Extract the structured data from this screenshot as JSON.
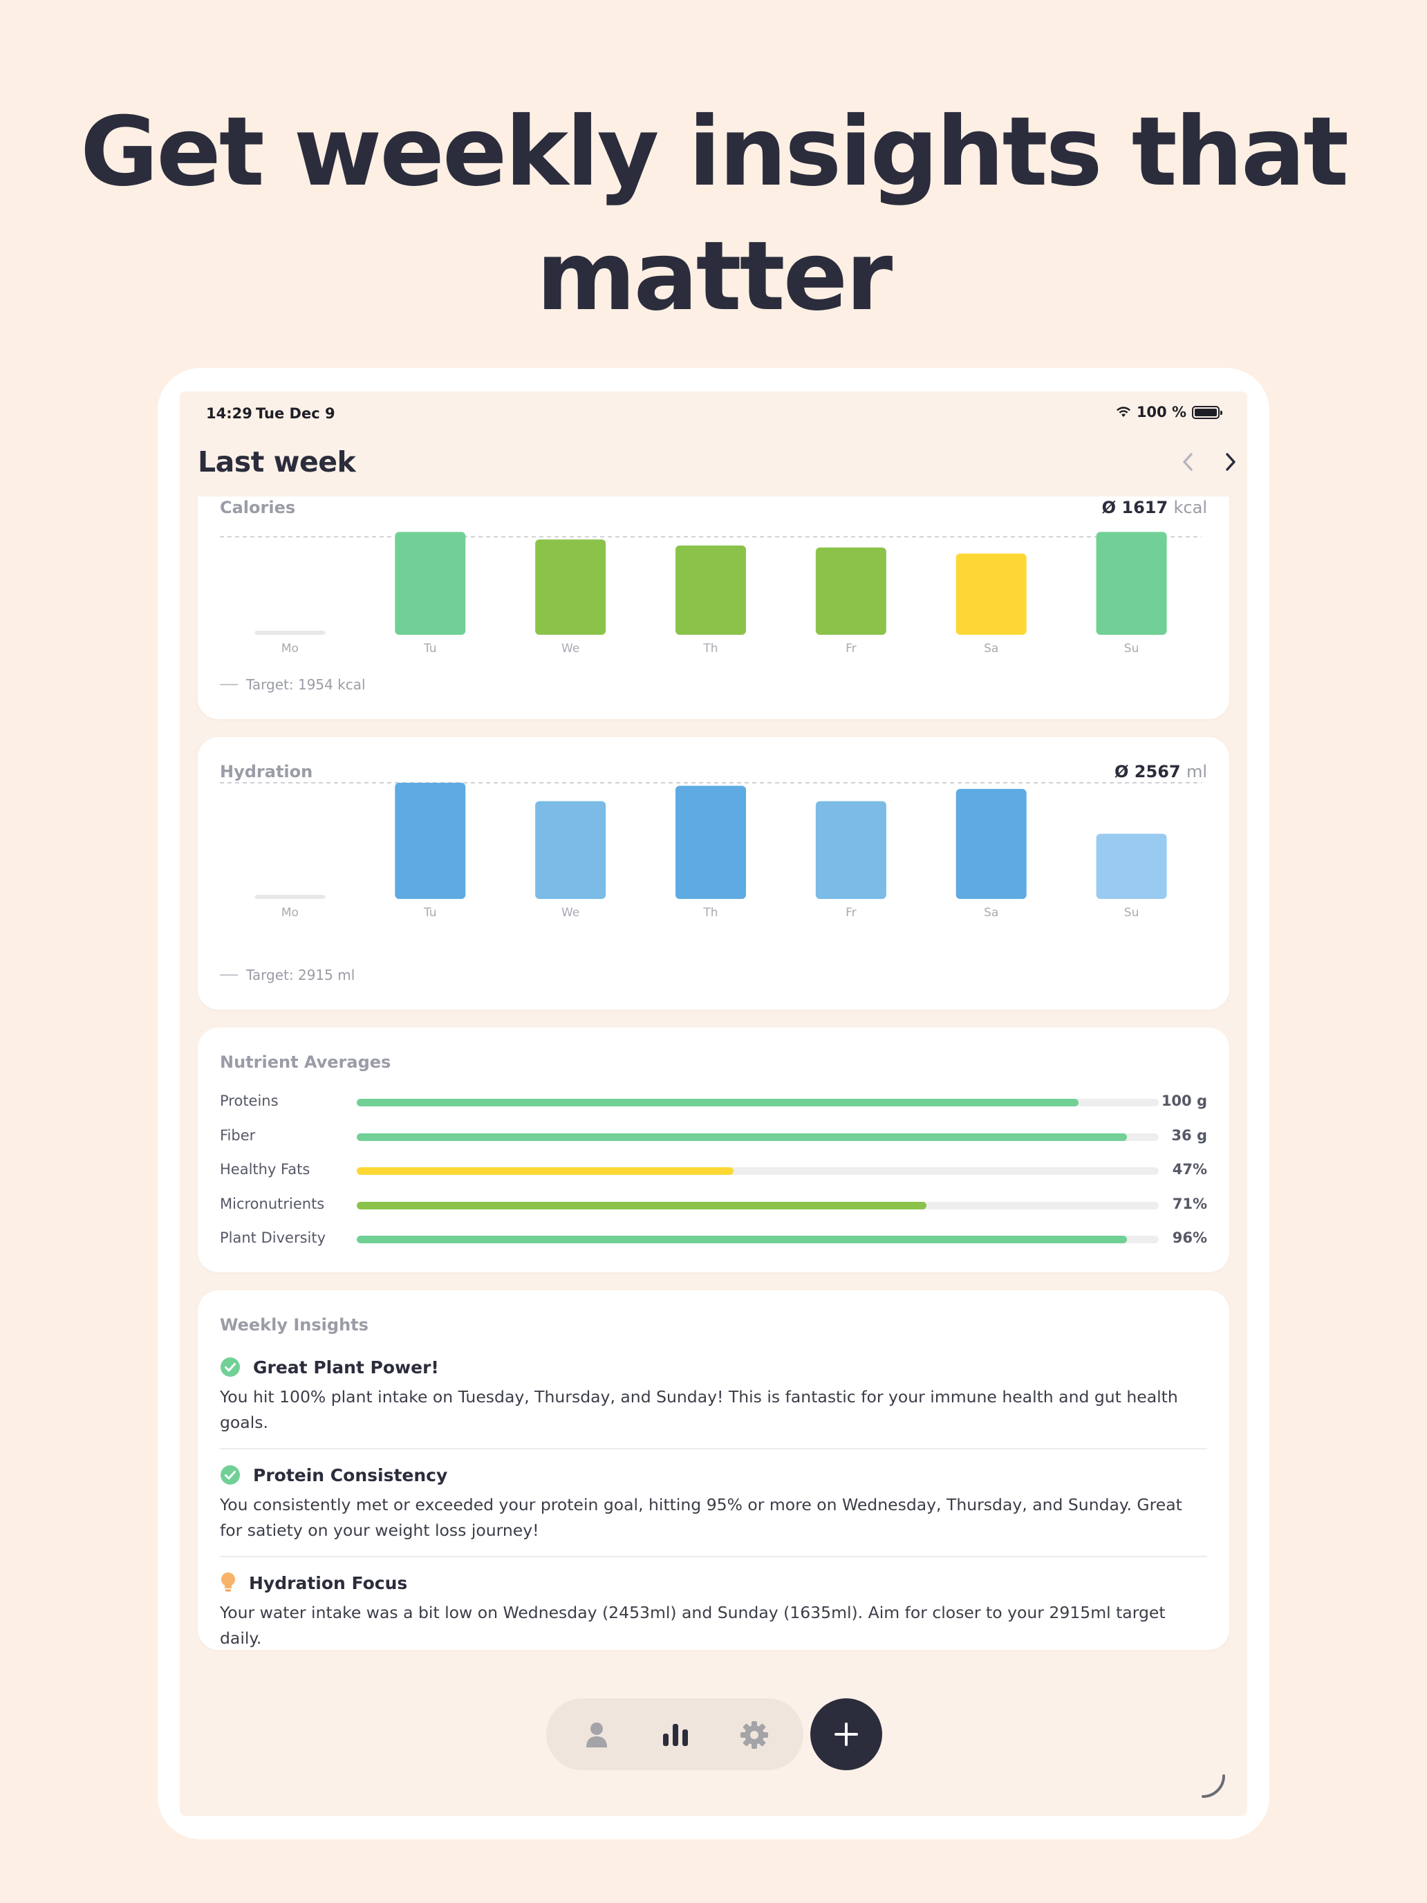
{
  "headline": {
    "line1": "Get weekly insights that",
    "line2": "matter"
  },
  "status": {
    "time": "14:29",
    "date": "Tue Dec 9",
    "battery": "100 %",
    "wifi_icon": "wifi-icon",
    "battery_icon": "battery-icon"
  },
  "nav": {
    "title": "Last week",
    "prev_icon": "chevron-left-icon",
    "next_icon": "chevron-right-icon"
  },
  "calories": {
    "title": "Calories",
    "avg_symbol": "Ø",
    "avg_value": "1617",
    "avg_unit": "kcal",
    "target_label": "Target: 1954 kcal"
  },
  "hydration": {
    "title": "Hydration",
    "avg_symbol": "Ø",
    "avg_value": "2567",
    "avg_unit": "ml",
    "target_label": "Target: 2915 ml"
  },
  "chart_data": [
    {
      "type": "bar",
      "title": "Calories",
      "categories": [
        "Mo",
        "Tu",
        "We",
        "Th",
        "Fr",
        "Sa",
        "Su"
      ],
      "values": [
        0,
        2050,
        1900,
        1780,
        1740,
        1620,
        2050
      ],
      "target": 1954,
      "ylim": [
        0,
        2150
      ],
      "colors": [
        "#e8e8e8",
        "#71d096",
        "#8bc34a",
        "#8bc34a",
        "#8bc34a",
        "#fdd835",
        "#71d096"
      ]
    },
    {
      "type": "bar",
      "title": "Hydration",
      "categories": [
        "Mo",
        "Tu",
        "We",
        "Th",
        "Fr",
        "Sa",
        "Su"
      ],
      "values": [
        0,
        2915,
        2453,
        2840,
        2453,
        2760,
        1635
      ],
      "target": 2915,
      "ylim": [
        0,
        2915
      ],
      "colors": [
        "#e8e8e8",
        "#5dabe2",
        "#7bbbe6",
        "#5dabe2",
        "#7bbbe6",
        "#5dabe2",
        "#98cbef"
      ]
    }
  ],
  "nutrients": {
    "title": "Nutrient Averages",
    "items": [
      {
        "label": "Proteins",
        "value": "100 g",
        "fraction": 0.9,
        "color": "#71d096"
      },
      {
        "label": "Fiber",
        "value": "36 g",
        "fraction": 0.96,
        "color": "#71d096"
      },
      {
        "label": "Healthy Fats",
        "value": "47%",
        "fraction": 0.47,
        "color": "#fdd835"
      },
      {
        "label": "Micronutrients",
        "value": "71%",
        "fraction": 0.71,
        "color": "#8bc34a"
      },
      {
        "label": "Plant Diversity",
        "value": "96%",
        "fraction": 0.96,
        "color": "#71d096"
      }
    ]
  },
  "insights": {
    "title": "Weekly Insights",
    "items": [
      {
        "icon": "check-circle-icon",
        "title": "Great Plant Power!",
        "body": "You hit 100% plant intake on Tuesday, Thursday, and Sunday! This is fantastic for your immune health and gut health goals."
      },
      {
        "icon": "check-circle-icon",
        "title": "Protein Consistency",
        "body": "You consistently met or exceeded your protein goal, hitting 95% or more on Wednesday, Thursday, and Sunday. Great for satiety on your weight loss journey!"
      },
      {
        "icon": "lightbulb-icon",
        "title": "Hydration Focus",
        "body": "Your water intake was a bit low on Wednesday (2453ml) and Sunday (1635ml). Aim for closer to your 2915ml target daily."
      }
    ]
  },
  "tabbar": {
    "items": [
      "person-icon",
      "bar-chart-icon",
      "gear-icon"
    ],
    "fab_icon": "plus-icon"
  },
  "colors": {
    "background": "#fdefe4",
    "screen": "#fcf1e8",
    "text_dark": "#2b2d3c",
    "muted": "#9a9ca6"
  }
}
